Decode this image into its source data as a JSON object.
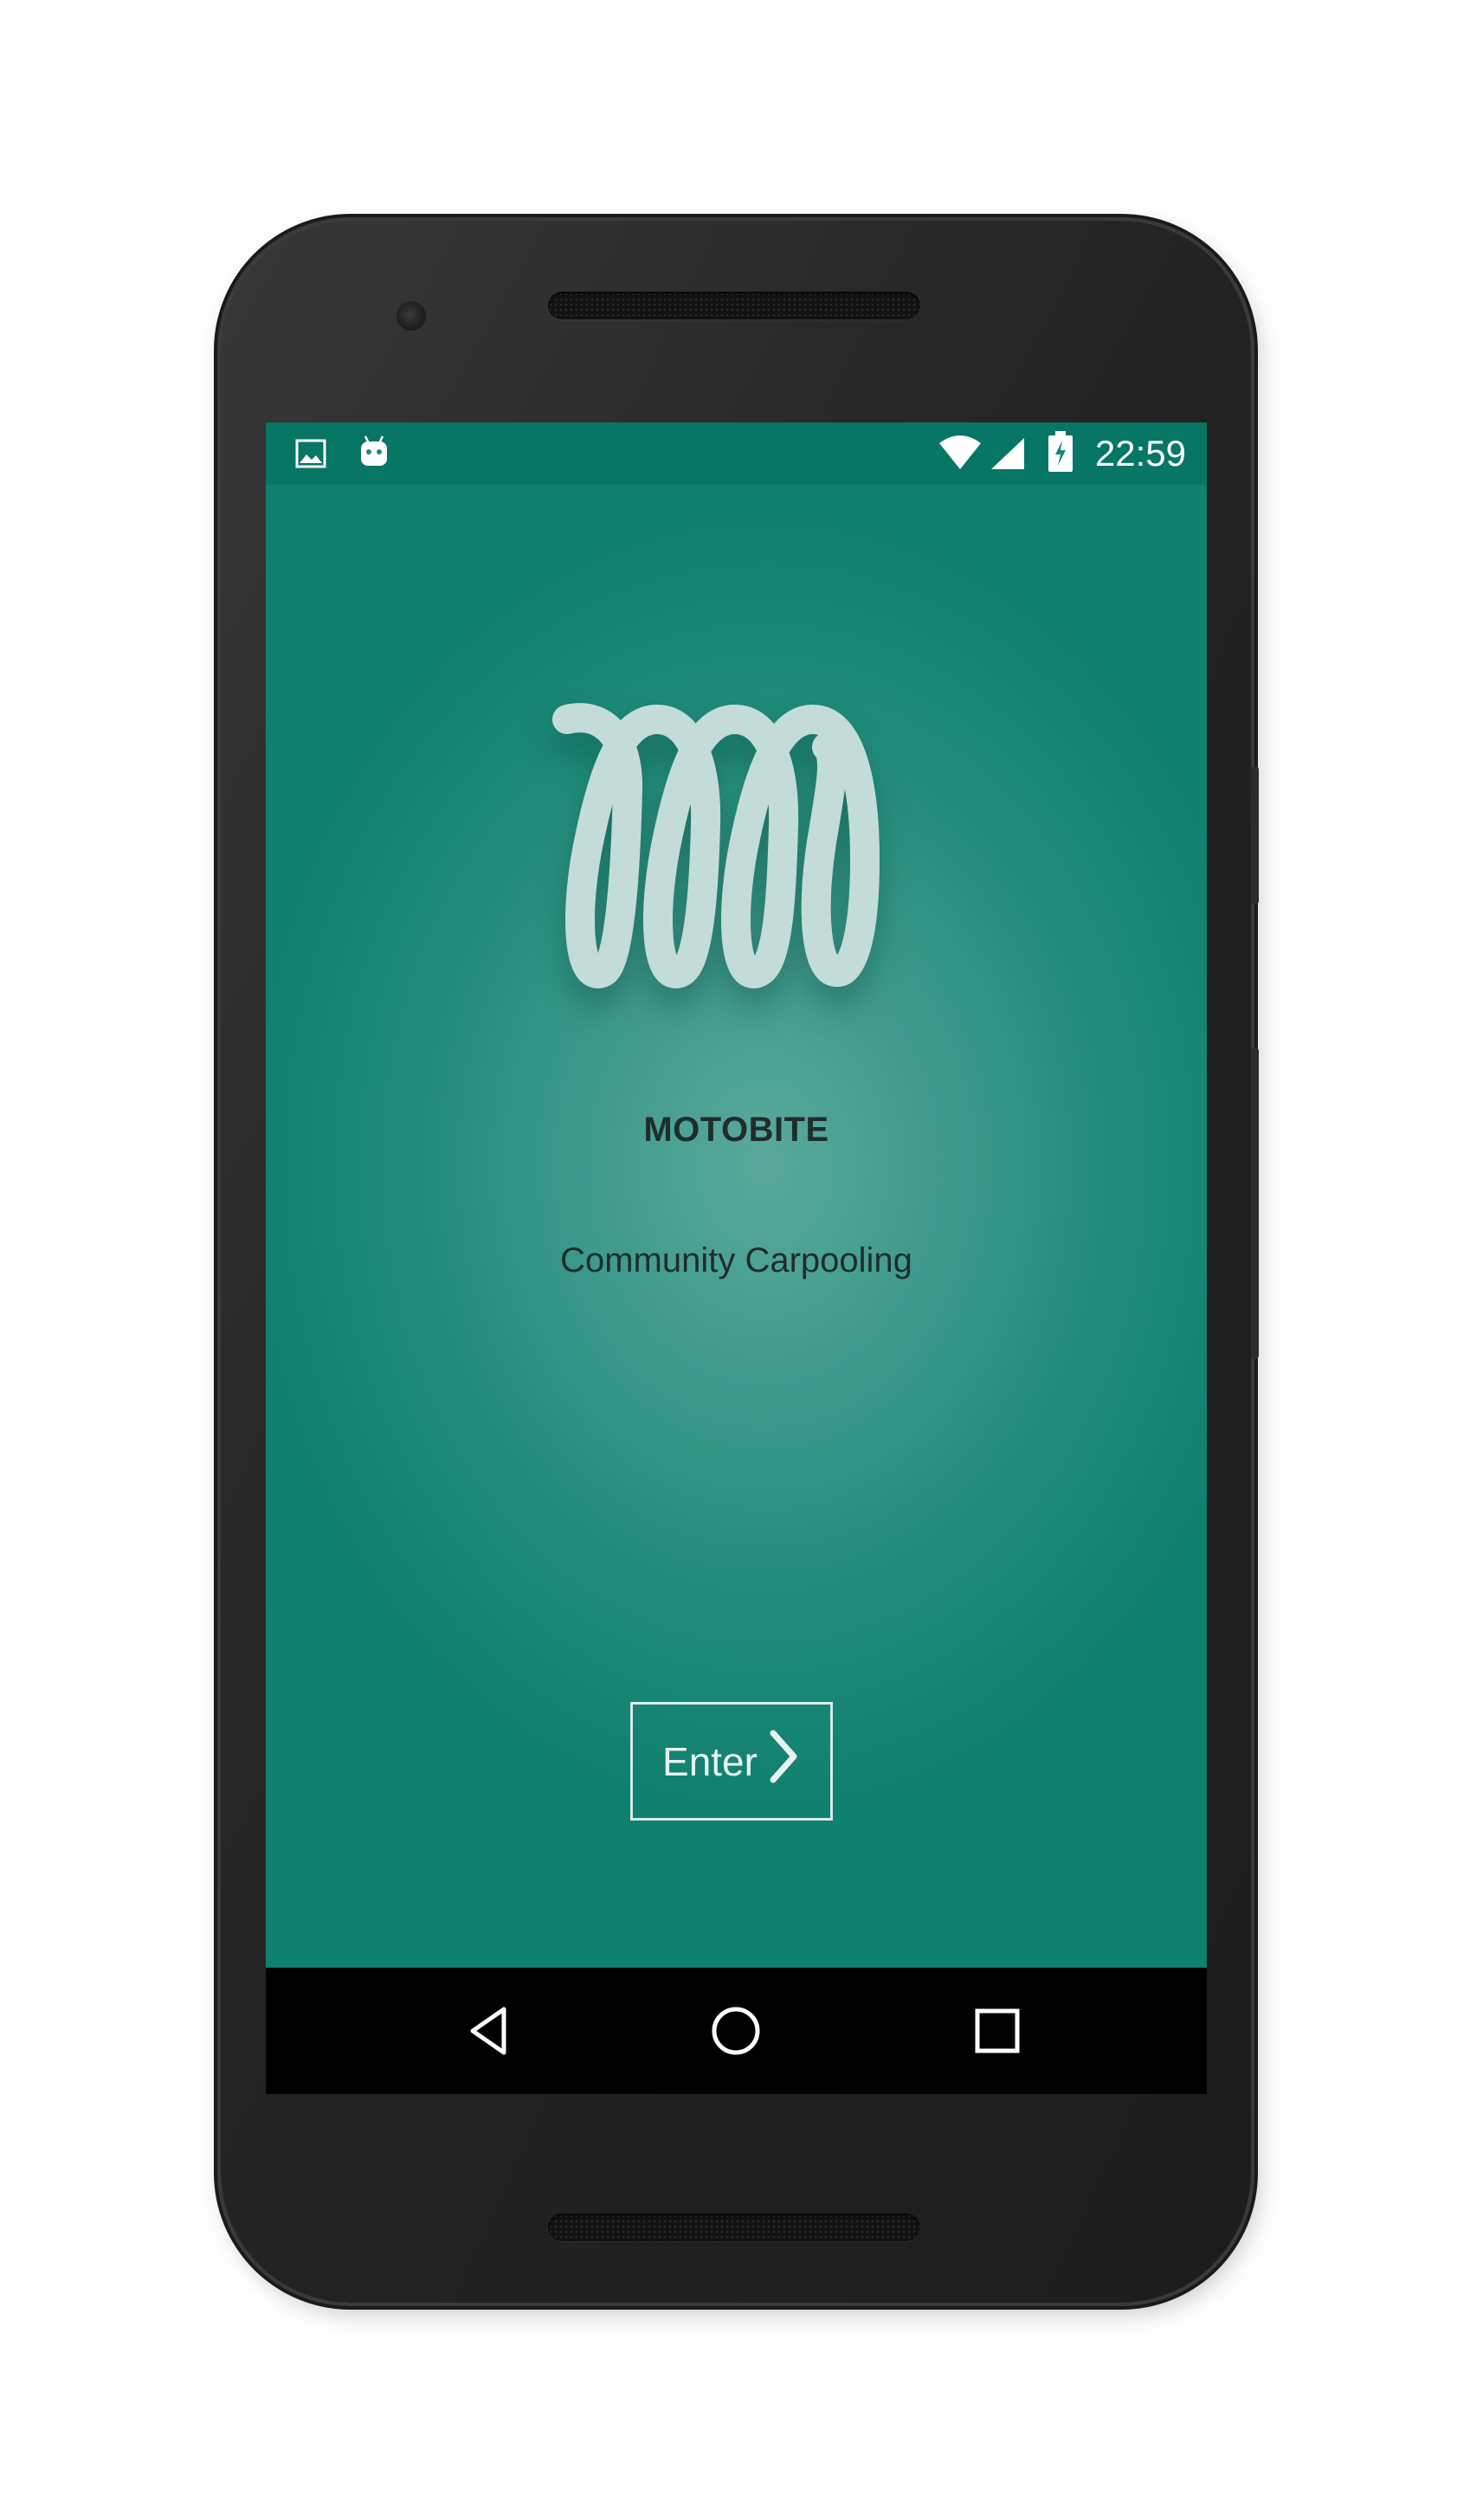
{
  "status_bar": {
    "time": "22:59",
    "left_icons": [
      "image-icon",
      "android-icon"
    ],
    "right_icons": [
      "wifi-icon",
      "cell-signal-icon",
      "battery-charging-icon"
    ]
  },
  "app": {
    "name": "MOTOBITE",
    "tagline": "Community Carpooling",
    "enter_label": "Enter",
    "logo_icon": "spiral-loop-logo",
    "colors": {
      "background": "#10806f",
      "background_center": "#5aa99c",
      "logo": "#c3dcd8",
      "text": "#1f2d2b",
      "button_border": "#d9ece8"
    }
  },
  "nav_bar": {
    "buttons": [
      "back-icon",
      "home-icon",
      "recents-icon"
    ]
  }
}
